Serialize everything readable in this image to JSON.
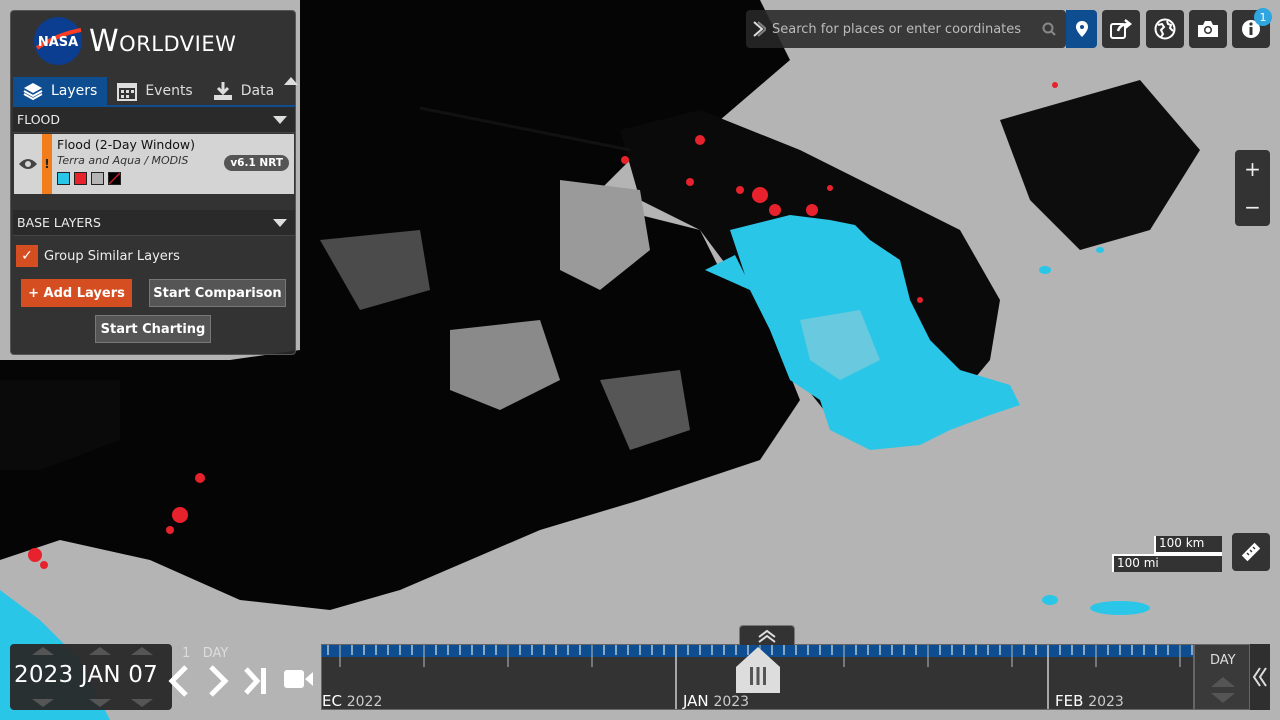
{
  "app": {
    "brand": "Worldview",
    "agency": "NASA"
  },
  "sidebar": {
    "tabs": [
      {
        "label": "Layers",
        "icon": "layers-icon",
        "active": true
      },
      {
        "label": "Events",
        "icon": "calendar-icon",
        "active": false
      },
      {
        "label": "Data",
        "icon": "download-icon",
        "active": false
      }
    ],
    "groups": {
      "overlay": {
        "title": "FLOOD"
      },
      "base": {
        "title": "BASE LAYERS"
      }
    },
    "layer": {
      "title": "Flood (2-Day Window)",
      "subtitle": "Terra and Aqua / MODIS",
      "version": "v6.1 NRT",
      "warning": "!",
      "legend_colors": [
        "#2ac6e8",
        "#e8222c",
        "#b4b4b4",
        "#000000"
      ]
    },
    "group_similar": {
      "label": "Group Similar Layers",
      "checked": true
    },
    "buttons": {
      "add_layers": "+ Add Layers",
      "start_comparison": "Start Comparison",
      "start_charting": "Start Charting"
    }
  },
  "toolbar": {
    "search_placeholder": "Search for places or enter coordinates",
    "info_badge": "1"
  },
  "map": {
    "scale_km": "100 km",
    "scale_mi": "100 mi",
    "colors": {
      "land": "#b4b4b4",
      "water": "#000000",
      "flood": "#2ac6e8",
      "flood_recurring": "#e8222c"
    }
  },
  "zoom": {
    "in": "+",
    "out": "−"
  },
  "timeline": {
    "year": "2023",
    "month": "JAN",
    "day": "07",
    "interval_amount": "1",
    "interval_unit": "DAY",
    "zoom_level": "DAY",
    "months": [
      {
        "month": "EC",
        "year": "2022"
      },
      {
        "month": "JAN",
        "year": "2023"
      },
      {
        "month": "FEB",
        "year": "2023"
      }
    ]
  }
}
